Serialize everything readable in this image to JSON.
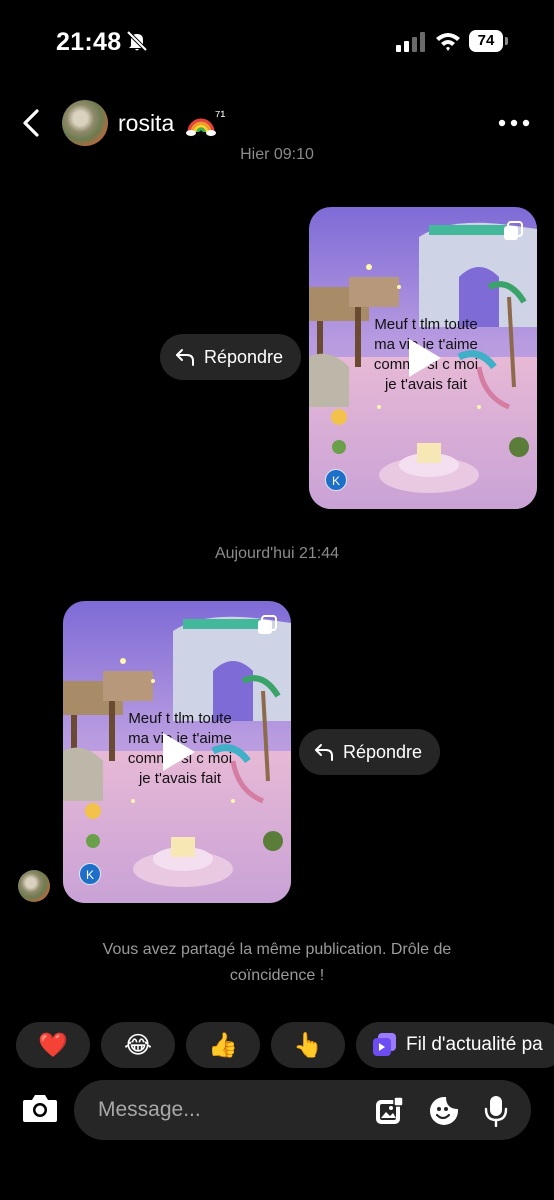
{
  "status_bar": {
    "time": "21:48",
    "battery": "74"
  },
  "header": {
    "contact_name": "rosita",
    "name_emoji": "🌈",
    "name_suffix": "⁷¹"
  },
  "thread": {
    "earlier_timestamp": "Hier 09:10",
    "timestamp": "Aujourd'hui 21:44",
    "reply_label": "Répondre",
    "post_overlay_text": "Meuf t tlm toute ma vie je t'aime comme si c moi je t'avais fait",
    "post_badge": "K",
    "coincidence_note": "Vous avez partagé la même publication. Drôle de coïncidence !"
  },
  "reactions": [
    {
      "emoji": "❤️",
      "icon": "heart-emoji"
    },
    {
      "emoji": "😂",
      "icon": "laughing-emoji"
    },
    {
      "emoji": "👍",
      "icon": "thumbs-up-emoji"
    },
    {
      "emoji": "👆",
      "icon": "pointing-up-emoji"
    }
  ],
  "feed_chip": {
    "label": "Fil d'actualité pa",
    "icon": "feed-icon"
  },
  "composer": {
    "placeholder": "Message..."
  },
  "colors": {
    "background": "#000000",
    "bubble": "#262626",
    "muted_text": "#8b8b8b",
    "feed_accent": "#7b5cf0"
  }
}
